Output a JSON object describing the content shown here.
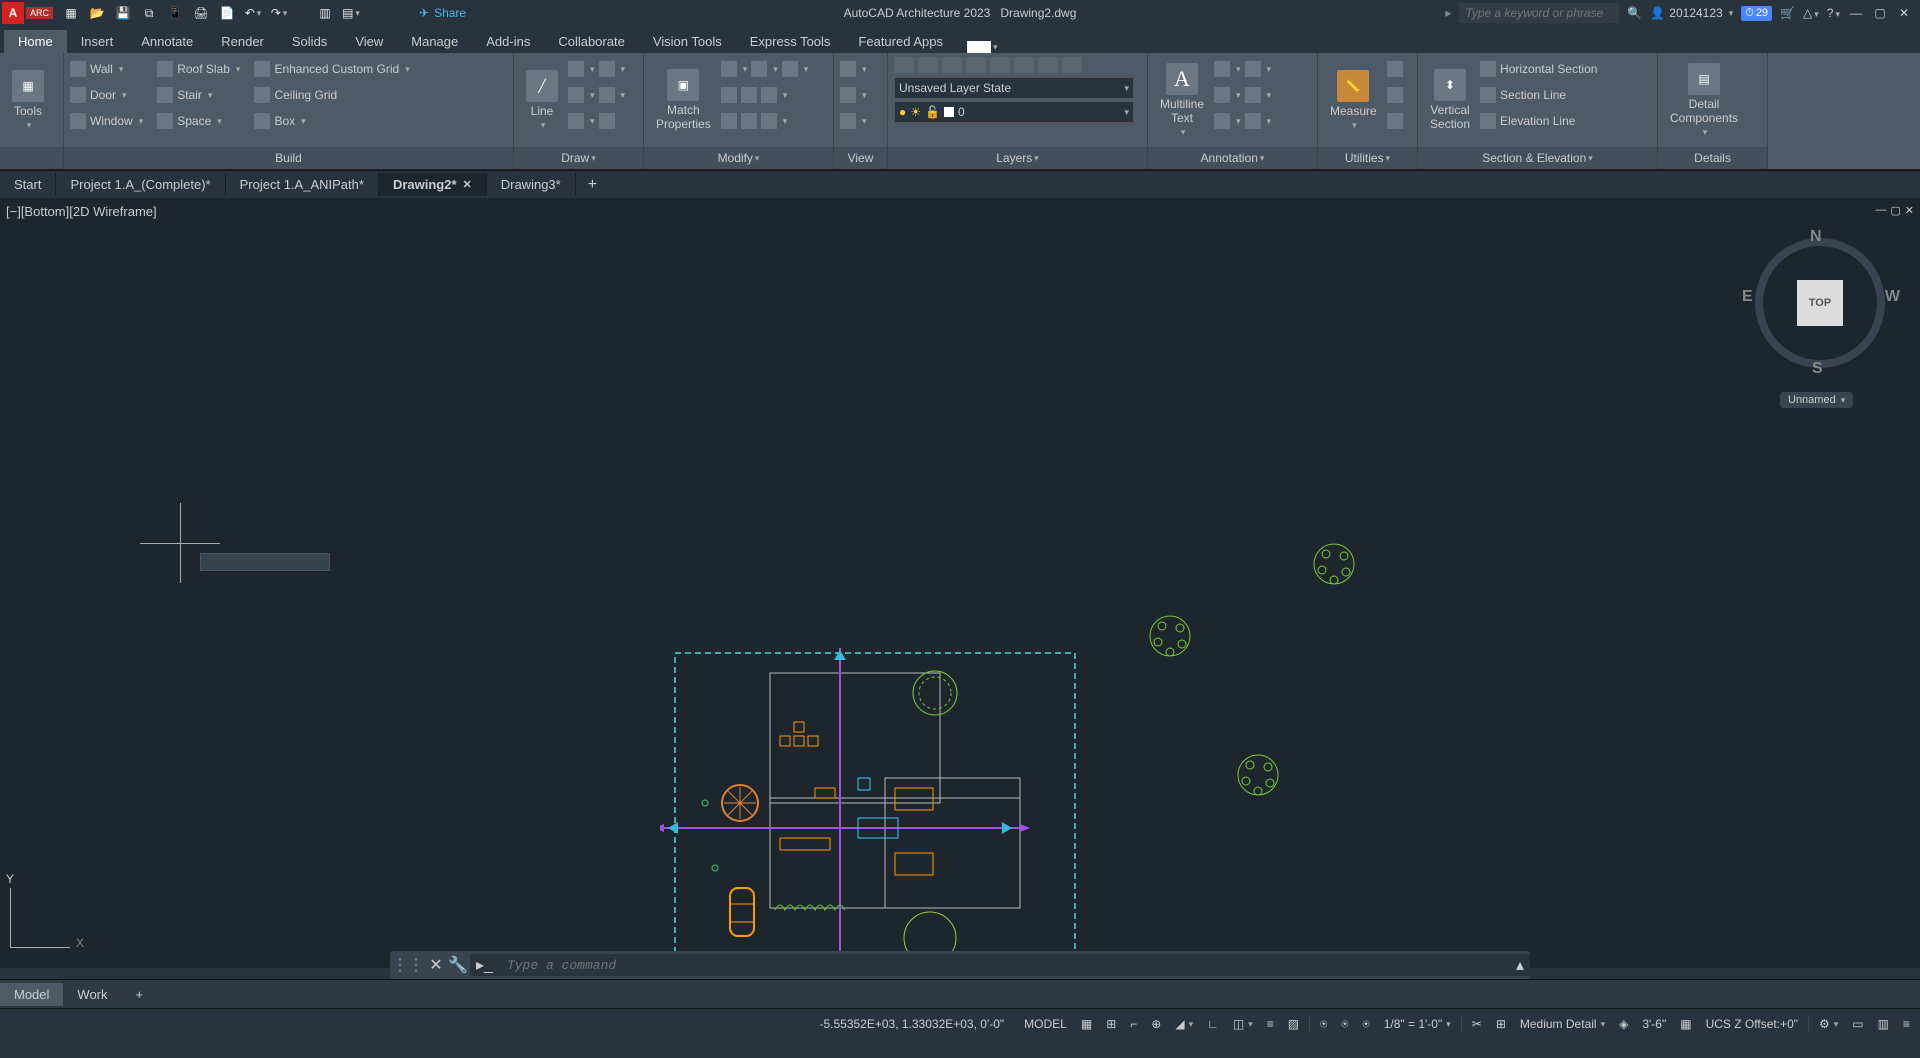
{
  "app_title": "AutoCAD Architecture 2023",
  "file_name": "Drawing2.dwg",
  "qat": {
    "share_label": "Share"
  },
  "search_placeholder": "Type a keyword or phrase",
  "user_name": "20124123",
  "notif_count": "29",
  "menu_tabs": [
    "Home",
    "Insert",
    "Annotate",
    "Render",
    "Solids",
    "View",
    "Manage",
    "Add-ins",
    "Collaborate",
    "Vision Tools",
    "Express Tools",
    "Featured Apps"
  ],
  "menu_active": 0,
  "ribbon": {
    "tools_label": "Tools",
    "build": {
      "title": "Build",
      "wall": "Wall",
      "door": "Door",
      "window": "Window",
      "roofslab": "Roof Slab",
      "stair": "Stair",
      "space": "Space",
      "grid": "Enhanced Custom Grid",
      "ceiling": "Ceiling Grid",
      "box": "Box"
    },
    "draw": {
      "title": "Draw",
      "line": "Line"
    },
    "modify": {
      "title": "Modify",
      "match": "Match\nProperties"
    },
    "view": {
      "title": "View"
    },
    "layers": {
      "title": "Layers",
      "state": "Unsaved Layer State",
      "current": "0"
    },
    "annotation": {
      "title": "Annotation",
      "text": "Multiline\nText"
    },
    "utilities": {
      "title": "Utilities",
      "measure": "Measure"
    },
    "section": {
      "title": "Section & Elevation",
      "vert": "Vertical\nSection",
      "horiz": "Horizontal Section",
      "secline": "Section Line",
      "elevline": "Elevation Line"
    },
    "details": {
      "title": "Details",
      "comp": "Detail\nComponents"
    }
  },
  "doc_tabs": [
    {
      "label": "Start",
      "close": false
    },
    {
      "label": "Project 1.A_(Complete)*",
      "close": false
    },
    {
      "label": "Project 1.A_ANIPath*",
      "close": false
    },
    {
      "label": "Drawing2*",
      "close": true,
      "active": true
    },
    {
      "label": "Drawing3*",
      "close": false
    }
  ],
  "viewport_label": "[−][Bottom][2D Wireframe]",
  "navcube": {
    "top": "TOP",
    "n": "N",
    "s": "S",
    "e": "E",
    "w": "W",
    "unnamed": "Unnamed"
  },
  "ucs_labels": {
    "y": "Y",
    "x": "X"
  },
  "command_placeholder": "Type a command",
  "layout_tabs": [
    "Model",
    "Work"
  ],
  "layout_active": 0,
  "status": {
    "coords": "-5.55352E+03, 1.33032E+03, 0'-0\"",
    "model_badge": "MODEL",
    "scale": "1/8\" = 1'-0\"",
    "detail": "Medium Detail",
    "elev": "3'-6\"",
    "ucs": "UCS Z Offset:+0\""
  }
}
